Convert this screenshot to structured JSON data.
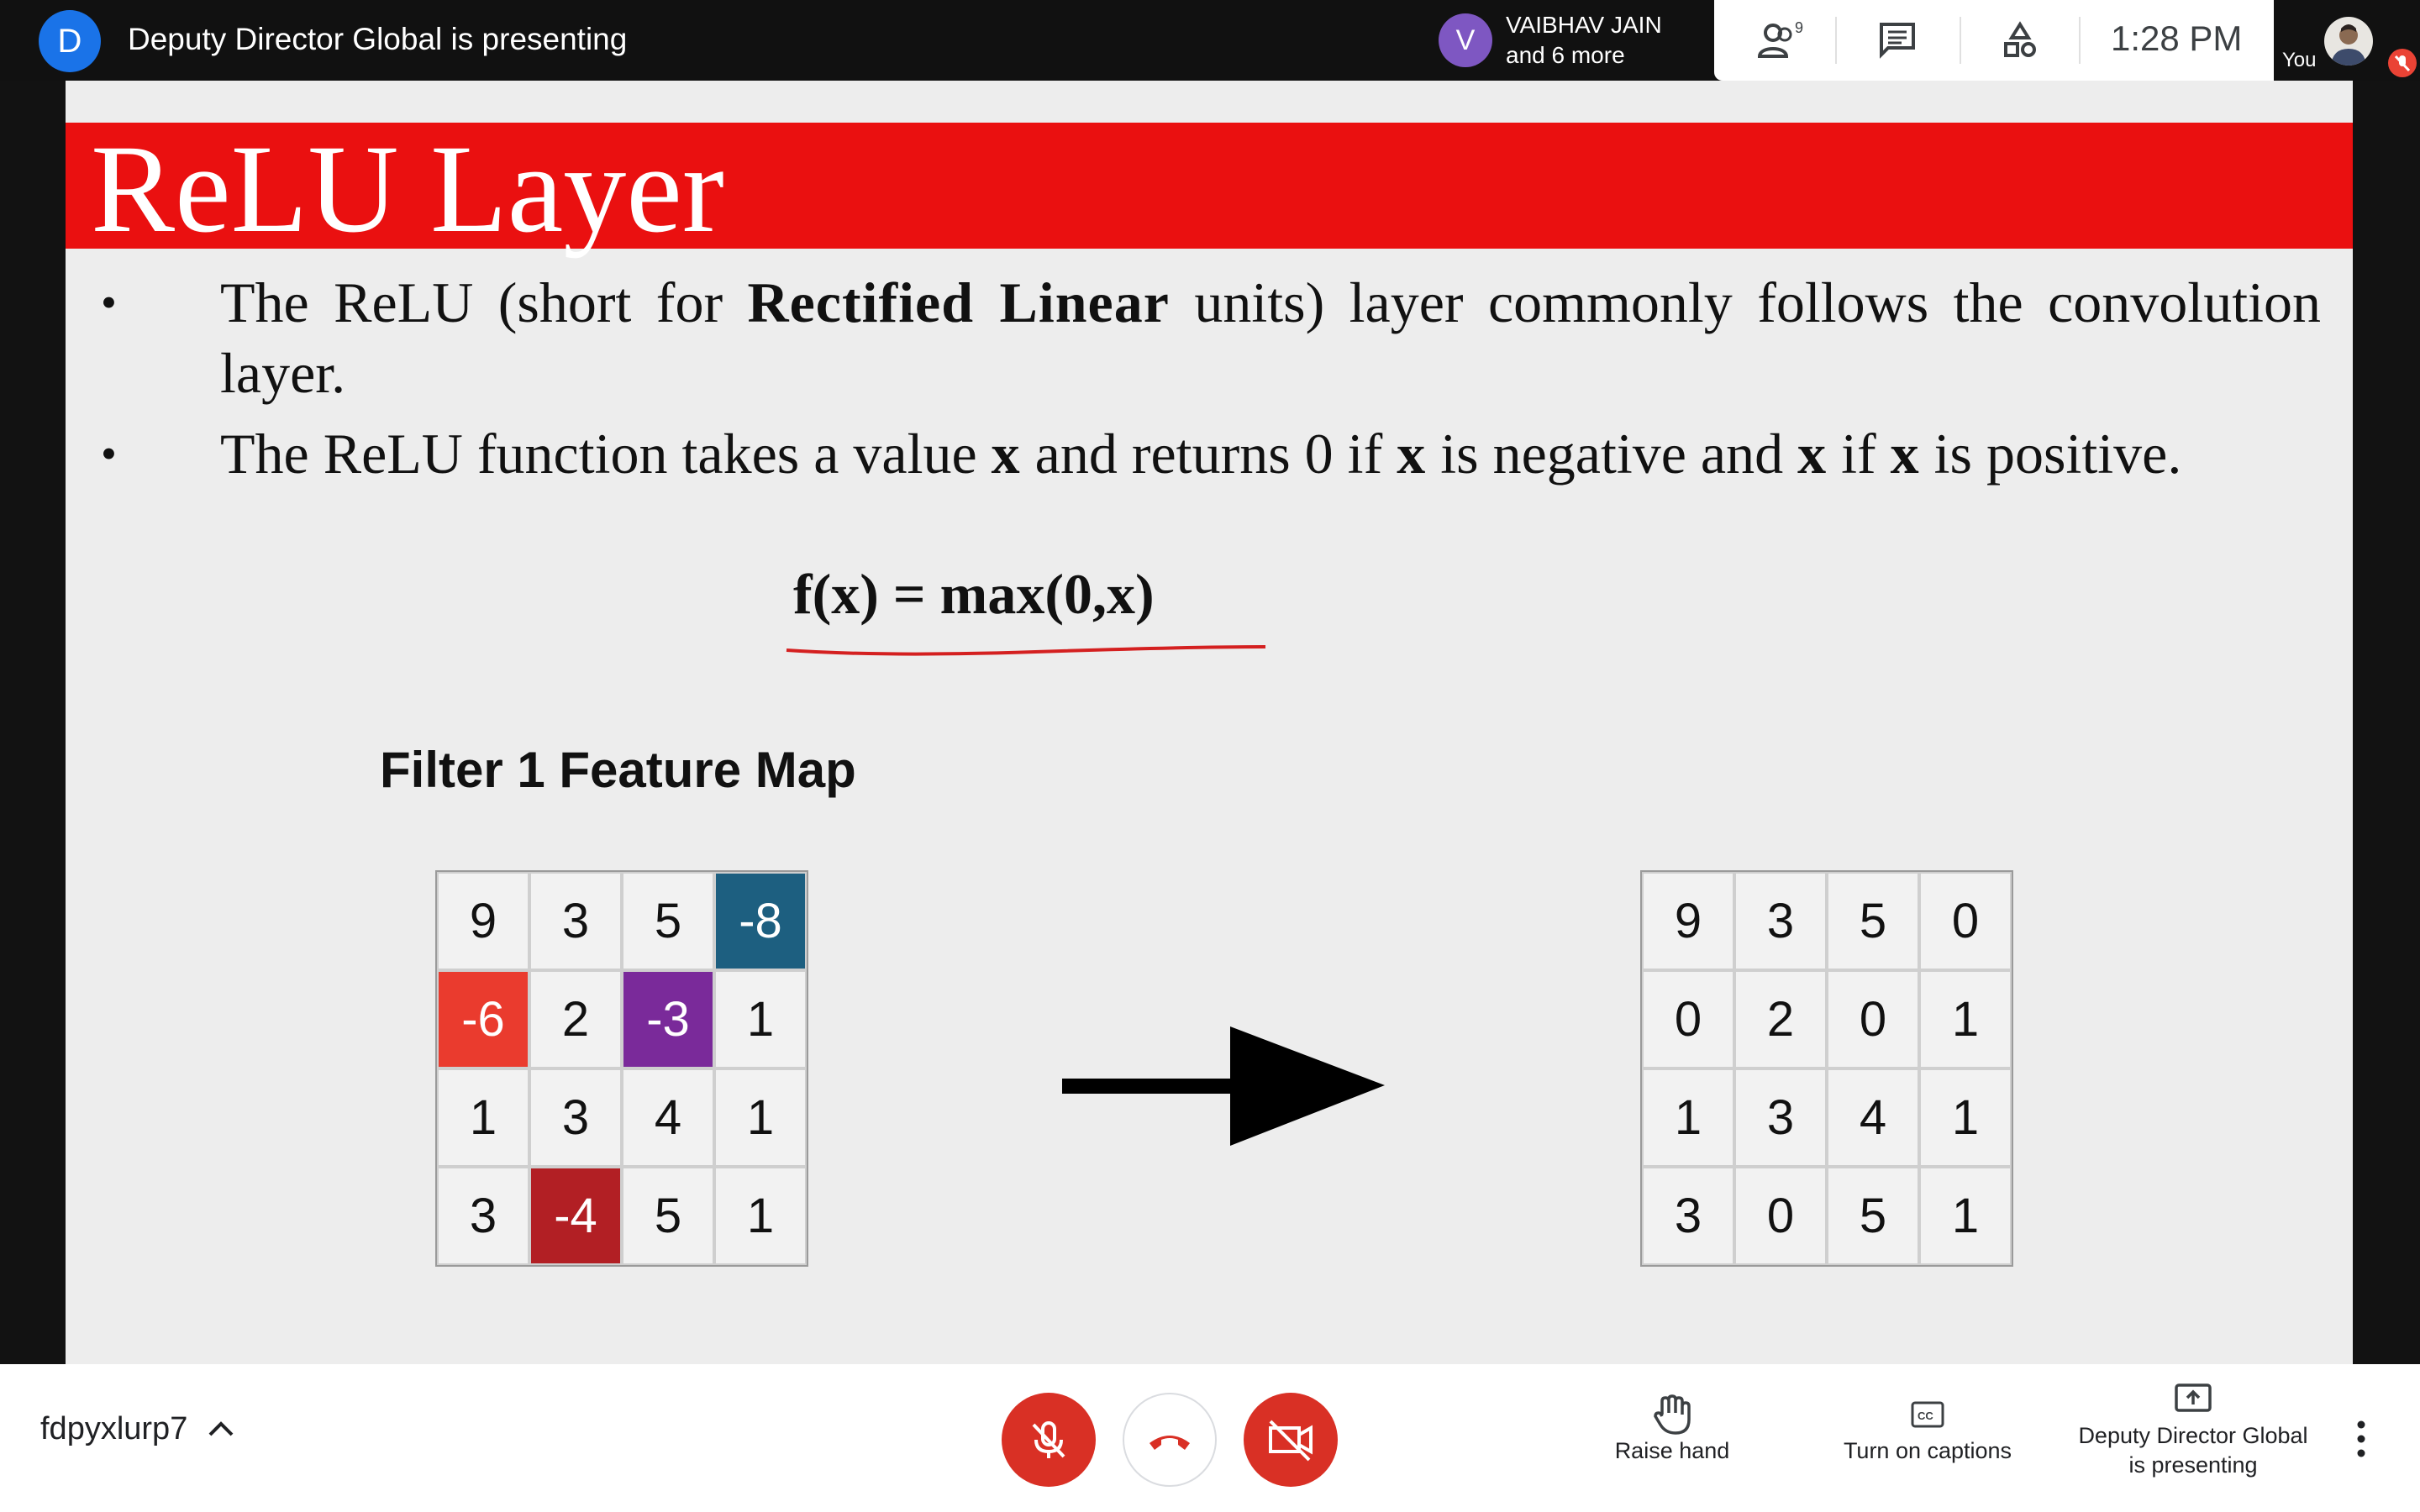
{
  "topbar": {
    "presenter_initial": "D",
    "presenter_text": "Deputy Director Global is presenting",
    "participant": {
      "initial": "V",
      "name": "VAIBHAV JAIN",
      "more": "and 6 more"
    },
    "people_count": "9",
    "clock": "1:28 PM",
    "self_label": "You",
    "accent_colors": {
      "presenter": "#1a73e8",
      "participant": "#7e57c2",
      "mute": "#ea4335"
    }
  },
  "slide": {
    "title": "ReLU Layer",
    "bullet1": {
      "pre": "The ReLU (short for ",
      "bold": "Rectified Linear",
      "post": " units) layer commonly follows the convolution layer."
    },
    "bullet2": {
      "a": "The ReLU function takes a value ",
      "x1": "x",
      "b": " and returns 0 if ",
      "x2": "x",
      "c": " is negative and ",
      "x3": "x",
      "d": " if ",
      "x4": "x",
      "e": " is positive."
    },
    "formula": "f(x) = max(0,x)",
    "map_title": "Filter 1 Feature Map",
    "input_grid": [
      [
        "9",
        "3",
        "5",
        "-8"
      ],
      [
        "-6",
        "2",
        "-3",
        "1"
      ],
      [
        "1",
        "3",
        "4",
        "1"
      ],
      [
        "3",
        "-4",
        "5",
        "1"
      ]
    ],
    "output_grid": [
      [
        "9",
        "3",
        "5",
        "0"
      ],
      [
        "0",
        "2",
        "0",
        "1"
      ],
      [
        "1",
        "3",
        "4",
        "1"
      ],
      [
        "3",
        "0",
        "5",
        "1"
      ]
    ],
    "highlight_colors": {
      "-8": "#1d5f80",
      "-6": "#ea3b2e",
      "-3": "#7a2a9a",
      "-4": "#b21f24"
    }
  },
  "bottombar": {
    "meeting_code": "fdpyxlurp7",
    "raise_hand": "Raise hand",
    "captions": "Turn on captions",
    "presenting_line1": "Deputy Director Global",
    "presenting_line2": "is presenting"
  }
}
